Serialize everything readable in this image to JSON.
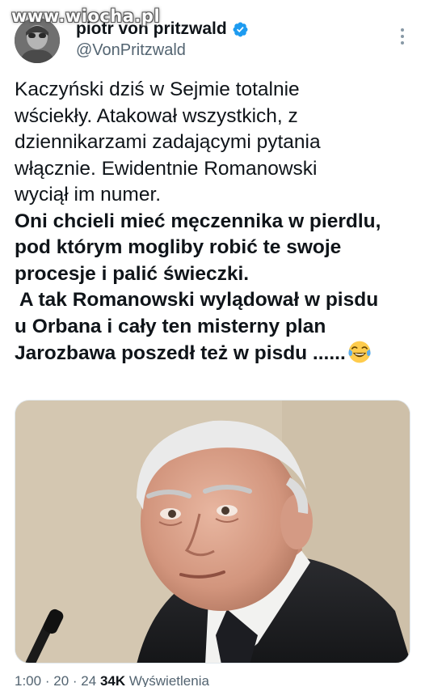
{
  "watermark": "www.wiocha.pl",
  "author": {
    "display_name": "piotr von pritzwald",
    "handle": "@VonPritzwald",
    "verified": true,
    "avatar_icon": "avatar-photo"
  },
  "menu_icon": "more-options-icon",
  "tweet": {
    "lines_regular": [
      "Kaczyński dziś w Sejmie totalnie",
      "wściekły. Atakował wszystkich, z",
      "dziennikarzami zadającymi pytania",
      "włącznie. Ewidentnie Romanowski",
      "wyciął im numer."
    ],
    "lines_bold": [
      "Oni chcieli mieć męczennika w pierdlu,",
      "pod którym mogliby robić te swoje",
      "procesje i palić świeczki.",
      " A tak Romanowski wylądował w pisdu",
      "u Orbana i cały ten misterny plan",
      "Jarozbawa poszedł też w pisdu ......"
    ],
    "emoji": "face-with-tears-of-joy"
  },
  "media": {
    "image": "portrait-photo-of-elderly-man-in-suit"
  },
  "meta": {
    "time": "1:00",
    "sep": "·",
    "date": "20",
    "sep2": "·",
    "year": "24",
    "views_count": "34K",
    "views_label": "Wyświetlenia"
  },
  "colors": {
    "verified_blue": "#1d9bf0",
    "text": "#0f1419",
    "secondary": "#536471"
  }
}
